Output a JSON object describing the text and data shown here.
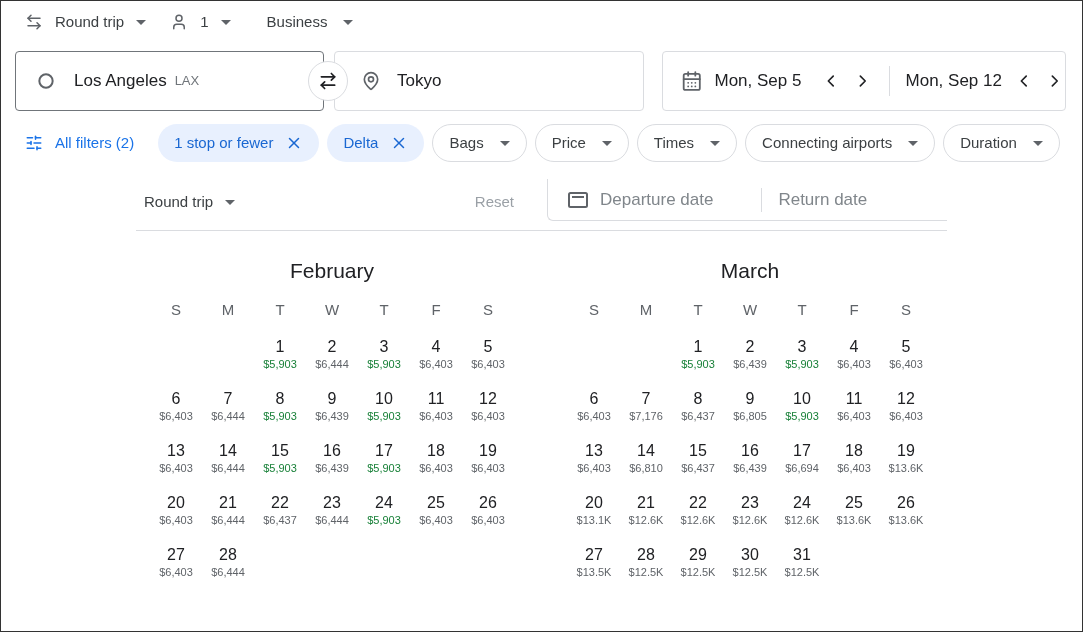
{
  "top_bar": {
    "trip_type": "Round trip",
    "passengers": "1",
    "cabin": "Business"
  },
  "search": {
    "origin": "Los Angeles",
    "origin_code": "LAX",
    "destination": "Tokyo",
    "departure": "Mon, Sep 5",
    "return": "Mon, Sep 12"
  },
  "filters": {
    "all_filters": "All filters (2)",
    "chips": [
      {
        "label": "1 stop or fewer",
        "kind": "active"
      },
      {
        "label": "Delta",
        "kind": "active"
      },
      {
        "label": "Bags",
        "kind": "dropdown"
      },
      {
        "label": "Price",
        "kind": "dropdown"
      },
      {
        "label": "Times",
        "kind": "dropdown"
      },
      {
        "label": "Connecting airports",
        "kind": "dropdown"
      },
      {
        "label": "Duration",
        "kind": "dropdown"
      }
    ]
  },
  "calendar": {
    "trip_type": "Round trip",
    "reset": "Reset",
    "departure_placeholder": "Departure date",
    "return_placeholder": "Return date",
    "months": [
      {
        "name": "February",
        "weekdays": [
          "S",
          "M",
          "T",
          "W",
          "T",
          "F",
          "S"
        ],
        "weeks": [
          [
            {
              "kind": "empty"
            },
            {
              "kind": "empty"
            },
            {
              "kind": "day",
              "day": "1",
              "price": "$5,903",
              "low": true
            },
            {
              "kind": "day",
              "day": "2",
              "price": "$6,444",
              "low": false
            },
            {
              "kind": "day",
              "day": "3",
              "price": "$5,903",
              "low": true
            },
            {
              "kind": "day",
              "day": "4",
              "price": "$6,403",
              "low": false
            },
            {
              "kind": "day",
              "day": "5",
              "price": "$6,403",
              "low": false
            }
          ],
          [
            {
              "kind": "day",
              "day": "6",
              "price": "$6,403",
              "low": false
            },
            {
              "kind": "day",
              "day": "7",
              "price": "$6,444",
              "low": false
            },
            {
              "kind": "day",
              "day": "8",
              "price": "$5,903",
              "low": true
            },
            {
              "kind": "day",
              "day": "9",
              "price": "$6,439",
              "low": false
            },
            {
              "kind": "day",
              "day": "10",
              "price": "$5,903",
              "low": true
            },
            {
              "kind": "day",
              "day": "11",
              "price": "$6,403",
              "low": false
            },
            {
              "kind": "day",
              "day": "12",
              "price": "$6,403",
              "low": false
            }
          ],
          [
            {
              "kind": "day",
              "day": "13",
              "price": "$6,403",
              "low": false
            },
            {
              "kind": "day",
              "day": "14",
              "price": "$6,444",
              "low": false
            },
            {
              "kind": "day",
              "day": "15",
              "price": "$5,903",
              "low": true
            },
            {
              "kind": "day",
              "day": "16",
              "price": "$6,439",
              "low": false
            },
            {
              "kind": "day",
              "day": "17",
              "price": "$5,903",
              "low": true
            },
            {
              "kind": "day",
              "day": "18",
              "price": "$6,403",
              "low": false
            },
            {
              "kind": "day",
              "day": "19",
              "price": "$6,403",
              "low": false
            }
          ],
          [
            {
              "kind": "day",
              "day": "20",
              "price": "$6,403",
              "low": false
            },
            {
              "kind": "day",
              "day": "21",
              "price": "$6,444",
              "low": false
            },
            {
              "kind": "day",
              "day": "22",
              "price": "$6,437",
              "low": false
            },
            {
              "kind": "day",
              "day": "23",
              "price": "$6,444",
              "low": false
            },
            {
              "kind": "day",
              "day": "24",
              "price": "$5,903",
              "low": true
            },
            {
              "kind": "day",
              "day": "25",
              "price": "$6,403",
              "low": false
            },
            {
              "kind": "day",
              "day": "26",
              "price": "$6,403",
              "low": false
            }
          ],
          [
            {
              "kind": "day",
              "day": "27",
              "price": "$6,403",
              "low": false
            },
            {
              "kind": "day",
              "day": "28",
              "price": "$6,444",
              "low": false
            }
          ]
        ]
      },
      {
        "name": "March",
        "weekdays": [
          "S",
          "M",
          "T",
          "W",
          "T",
          "F",
          "S"
        ],
        "weeks": [
          [
            {
              "kind": "empty"
            },
            {
              "kind": "empty"
            },
            {
              "kind": "day",
              "day": "1",
              "price": "$5,903",
              "low": true
            },
            {
              "kind": "day",
              "day": "2",
              "price": "$6,439",
              "low": false
            },
            {
              "kind": "day",
              "day": "3",
              "price": "$5,903",
              "low": true
            },
            {
              "kind": "day",
              "day": "4",
              "price": "$6,403",
              "low": false
            },
            {
              "kind": "day",
              "day": "5",
              "price": "$6,403",
              "low": false
            }
          ],
          [
            {
              "kind": "day",
              "day": "6",
              "price": "$6,403",
              "low": false
            },
            {
              "kind": "day",
              "day": "7",
              "price": "$7,176",
              "low": false
            },
            {
              "kind": "day",
              "day": "8",
              "price": "$6,437",
              "low": false
            },
            {
              "kind": "day",
              "day": "9",
              "price": "$6,805",
              "low": false
            },
            {
              "kind": "day",
              "day": "10",
              "price": "$5,903",
              "low": true
            },
            {
              "kind": "day",
              "day": "11",
              "price": "$6,403",
              "low": false
            },
            {
              "kind": "day",
              "day": "12",
              "price": "$6,403",
              "low": false
            }
          ],
          [
            {
              "kind": "day",
              "day": "13",
              "price": "$6,403",
              "low": false
            },
            {
              "kind": "day",
              "day": "14",
              "price": "$6,810",
              "low": false
            },
            {
              "kind": "day",
              "day": "15",
              "price": "$6,437",
              "low": false
            },
            {
              "kind": "day",
              "day": "16",
              "price": "$6,439",
              "low": false
            },
            {
              "kind": "day",
              "day": "17",
              "price": "$6,694",
              "low": false
            },
            {
              "kind": "day",
              "day": "18",
              "price": "$6,403",
              "low": false
            },
            {
              "kind": "day",
              "day": "19",
              "price": "$13.6K",
              "low": false
            }
          ],
          [
            {
              "kind": "day",
              "day": "20",
              "price": "$13.1K",
              "low": false
            },
            {
              "kind": "day",
              "day": "21",
              "price": "$12.6K",
              "low": false
            },
            {
              "kind": "day",
              "day": "22",
              "price": "$12.6K",
              "low": false
            },
            {
              "kind": "day",
              "day": "23",
              "price": "$12.6K",
              "low": false
            },
            {
              "kind": "day",
              "day": "24",
              "price": "$12.6K",
              "low": false
            },
            {
              "kind": "day",
              "day": "25",
              "price": "$13.6K",
              "low": false
            },
            {
              "kind": "day",
              "day": "26",
              "price": "$13.6K",
              "low": false
            }
          ],
          [
            {
              "kind": "day",
              "day": "27",
              "price": "$13.5K",
              "low": false
            },
            {
              "kind": "day",
              "day": "28",
              "price": "$12.5K",
              "low": false
            },
            {
              "kind": "day",
              "day": "29",
              "price": "$12.5K",
              "low": false
            },
            {
              "kind": "day",
              "day": "30",
              "price": "$12.5K",
              "low": false
            },
            {
              "kind": "day",
              "day": "31",
              "price": "$12.5K",
              "low": false
            }
          ]
        ]
      }
    ]
  }
}
